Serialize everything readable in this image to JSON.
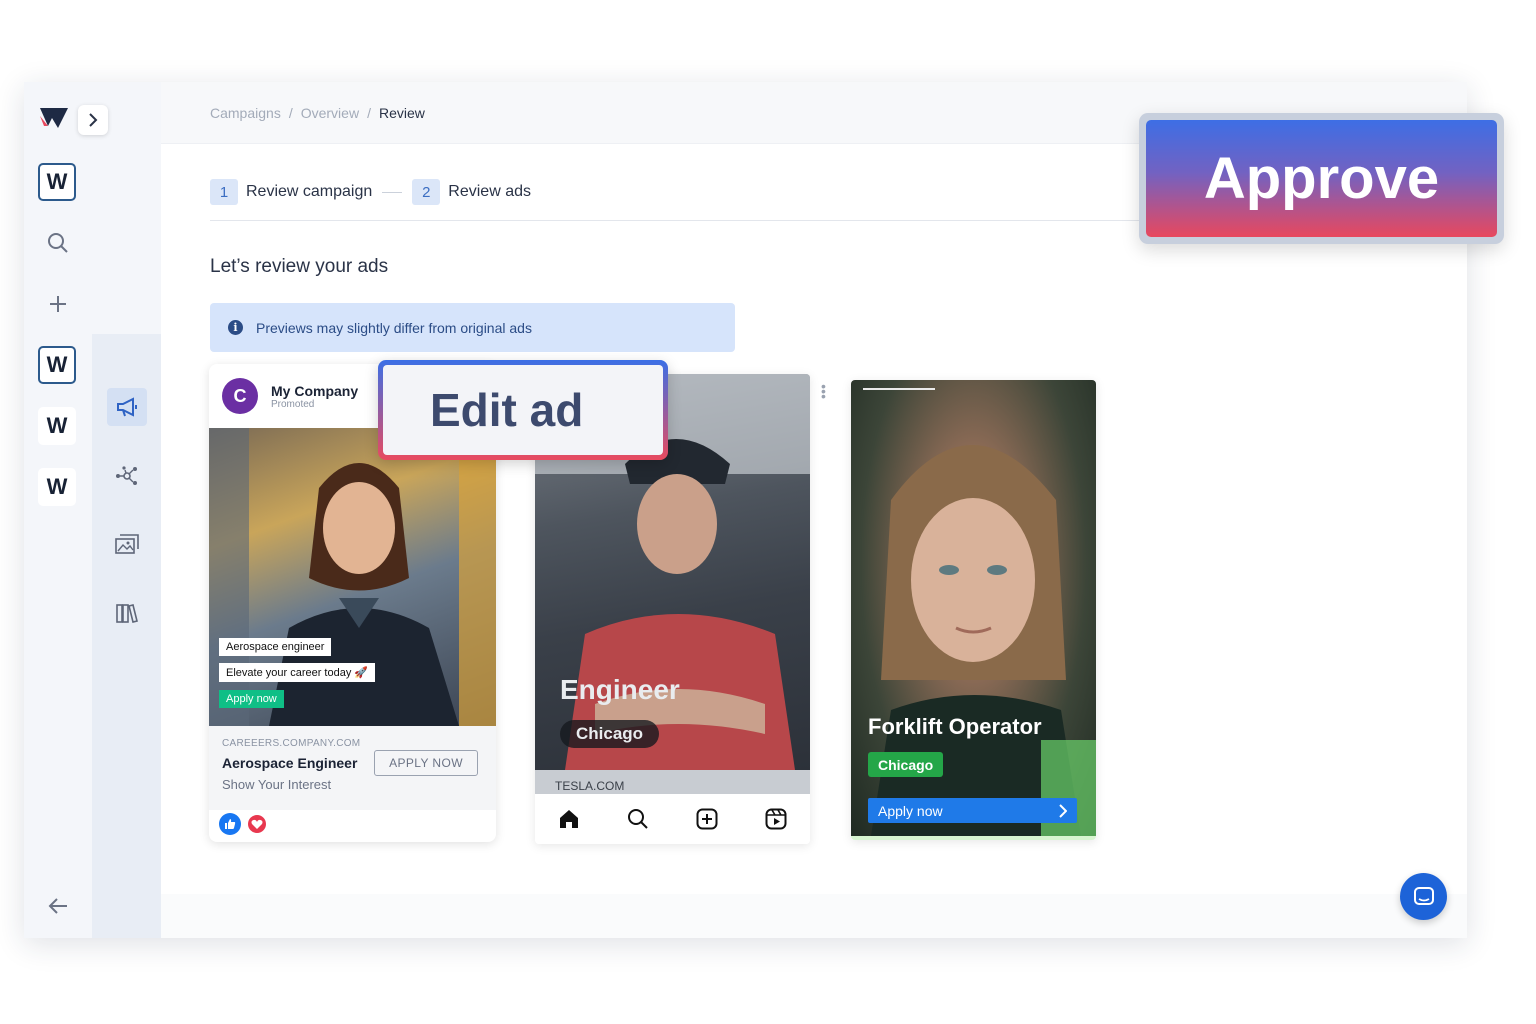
{
  "breadcrumbs": [
    "Campaigns",
    "Overview",
    "Review"
  ],
  "breadcrumb_separator": "/",
  "steps": [
    {
      "num": "1",
      "label": "Review campaign"
    },
    {
      "num": "2",
      "label": "Review ads"
    }
  ],
  "heading": "Let’s review your ads",
  "info_banner": {
    "icon": "info-icon",
    "text": "Previews may slightly differ from original ads"
  },
  "workspaces": [
    "W",
    "W",
    "W",
    "W"
  ],
  "ads": {
    "facebook": {
      "avatar_letter": "C",
      "company": "My Company",
      "promoted": "Promoted",
      "overlay_role": "Aerospace engineer",
      "overlay_tagline": "Elevate your career today 🚀",
      "overlay_cta": "Apply now",
      "domain": "CAREEERS.COMPANY.COM",
      "title": "Aerospace Engineer",
      "subtitle": "Show Your Interest",
      "cta": "APPLY NOW"
    },
    "instagram": {
      "title": "Engineer",
      "location": "Chicago",
      "domain": "TESLA.COM"
    },
    "story": {
      "title": "Forklift Operator",
      "location": "Chicago",
      "cta": "Apply now"
    }
  },
  "callouts": {
    "edit": "Edit ad",
    "approve": "Approve"
  },
  "colors": {
    "accent": "#1d63d8",
    "brand_green": "#0fbf86",
    "story_green": "#24a648",
    "story_blue": "#1f7ae8"
  }
}
